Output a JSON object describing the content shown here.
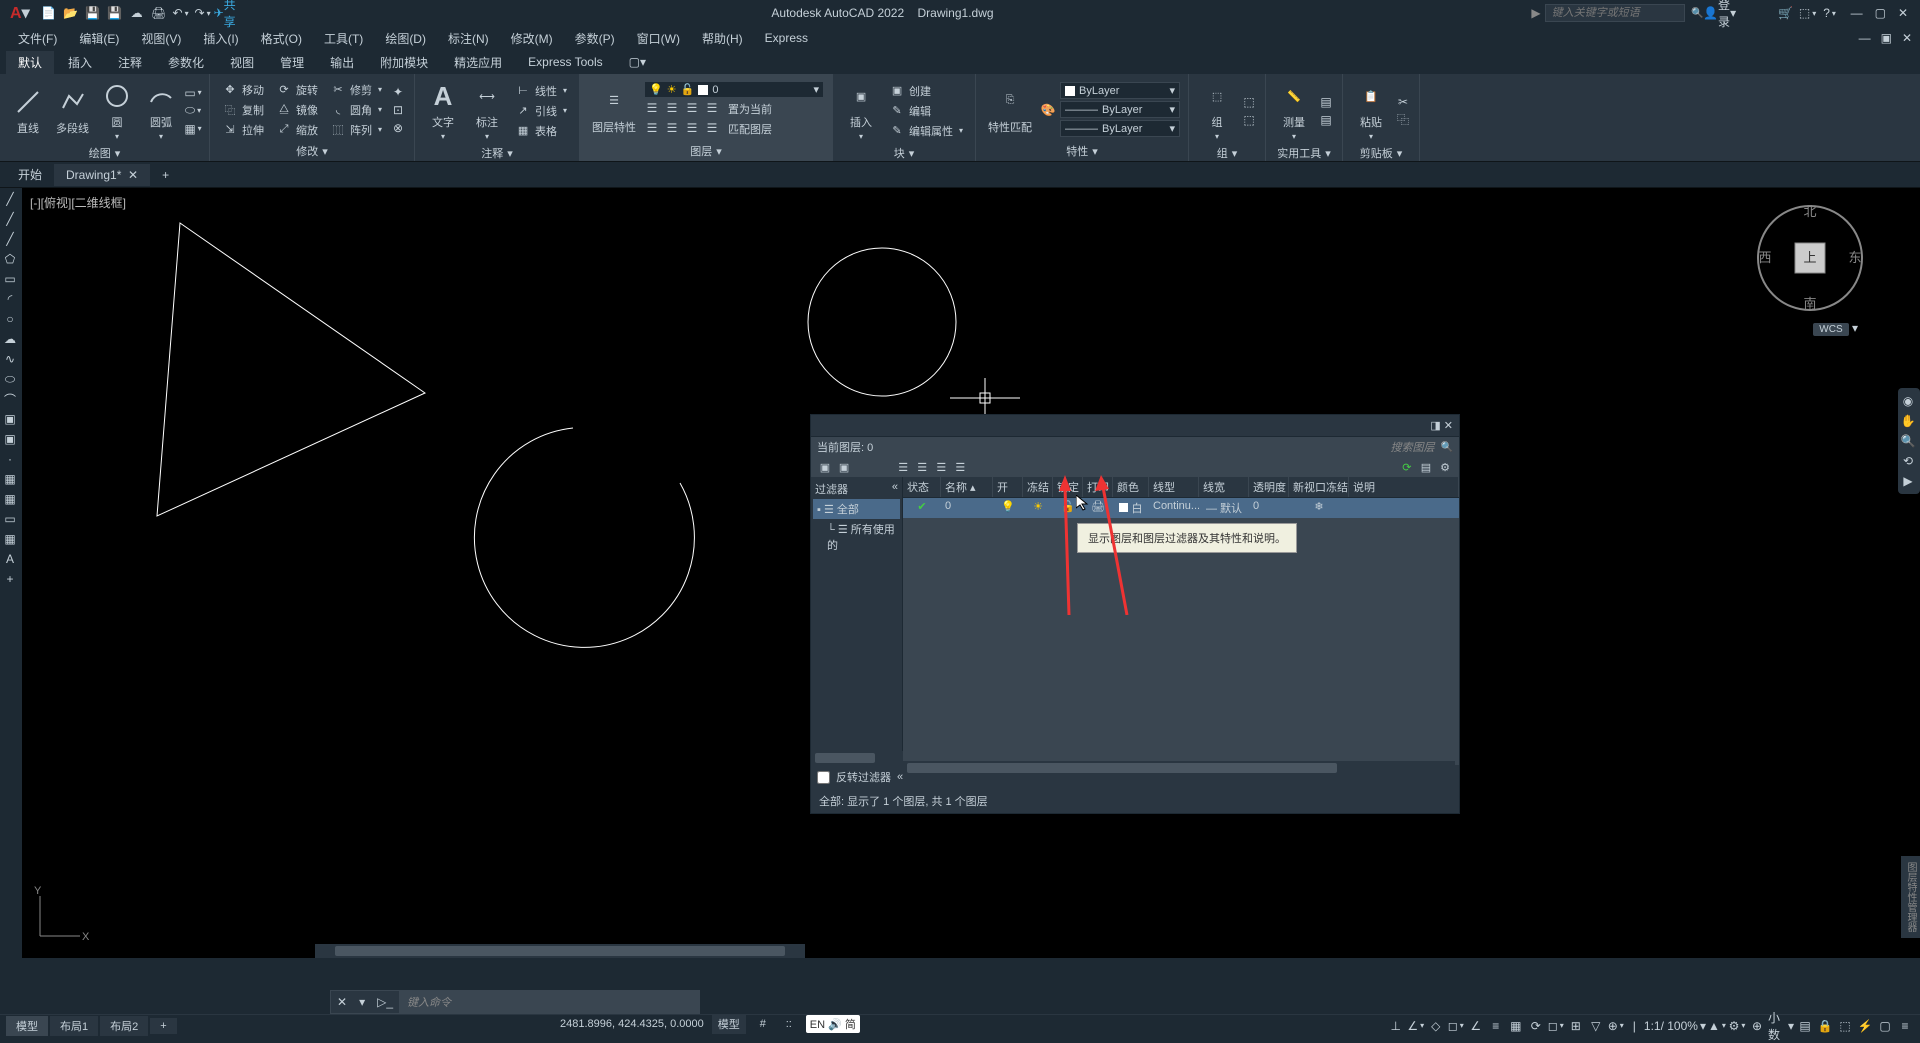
{
  "title": {
    "app": "Autodesk AutoCAD 2022",
    "file": "Drawing1.dwg"
  },
  "share_label": "共享",
  "search_placeholder": "键入关键字或短语",
  "login_label": "登录",
  "menus": [
    "文件(F)",
    "编辑(E)",
    "视图(V)",
    "插入(I)",
    "格式(O)",
    "工具(T)",
    "绘图(D)",
    "标注(N)",
    "修改(M)",
    "参数(P)",
    "窗口(W)",
    "帮助(H)",
    "Express"
  ],
  "ribbon_tabs": [
    "默认",
    "插入",
    "注释",
    "参数化",
    "视图",
    "管理",
    "输出",
    "附加模块",
    "精选应用",
    "Express Tools"
  ],
  "panels": {
    "draw": {
      "title": "绘图",
      "line": "直线",
      "polyline": "多段线",
      "circle": "圆",
      "arc": "圆弧"
    },
    "modify": {
      "title": "修改",
      "move": "移动",
      "rotate": "旋转",
      "trim": "修剪",
      "copy": "复制",
      "mirror": "镜像",
      "fillet": "圆角",
      "stretch": "拉伸",
      "scale": "缩放",
      "array": "阵列"
    },
    "annotate": {
      "title": "注释",
      "text": "文字",
      "dim": "标注",
      "linear": "线性",
      "leader": "引线",
      "table": "表格"
    },
    "layer": {
      "title": "图层",
      "props": "图层特性",
      "current": "0",
      "set_current": "置为当前",
      "match": "匹配图层"
    },
    "block": {
      "title": "块",
      "insert": "插入",
      "create": "创建",
      "edit": "编辑",
      "attr": "编辑属性"
    },
    "props": {
      "title": "特性",
      "match": "特性匹配",
      "bylayer": "ByLayer"
    },
    "group": {
      "title": "组",
      "group": "组"
    },
    "util": {
      "title": "实用工具",
      "measure": "测量"
    },
    "clip": {
      "title": "剪贴板",
      "paste": "粘贴"
    }
  },
  "doc_tabs": {
    "start": "开始",
    "drawing": "Drawing1*"
  },
  "view_label": "[-][俯视][二维线框]",
  "viewcube": {
    "n": "北",
    "s": "南",
    "e": "东",
    "w": "西",
    "top": "上",
    "wcs": "WCS"
  },
  "layer_panel": {
    "current": "当前图层: 0",
    "search": "搜索图层",
    "filter": "过滤器",
    "all": "全部",
    "used": "所有使用的",
    "invert": "反转过滤器",
    "status": "全部: 显示了 1 个图层, 共 1 个图层",
    "cols": {
      "state": "状态",
      "name": "名称",
      "on": "开",
      "freeze": "冻结",
      "lock": "锁定",
      "plot": "打印",
      "color": "颜色",
      "ltype": "线型",
      "lweight": "线宽",
      "trans": "透明度",
      "vpfreeze": "新视口冻结",
      "desc": "说明"
    },
    "row": {
      "name": "0",
      "color": "白",
      "ltype": "Continu...",
      "lweight": "默认",
      "trans": "0"
    },
    "tooltip": "显示图层和图层过滤器及其特性和说明。"
  },
  "cmd_placeholder": "键入命令",
  "layout_tabs": {
    "model": "模型",
    "l1": "布局1",
    "l2": "布局2"
  },
  "status": {
    "coords": "2481.8996, 424.4325, 0.0000",
    "model": "模型",
    "ime": "EN 🔊 简",
    "decimal": "小数",
    "scale": "1:1/ 100%"
  }
}
